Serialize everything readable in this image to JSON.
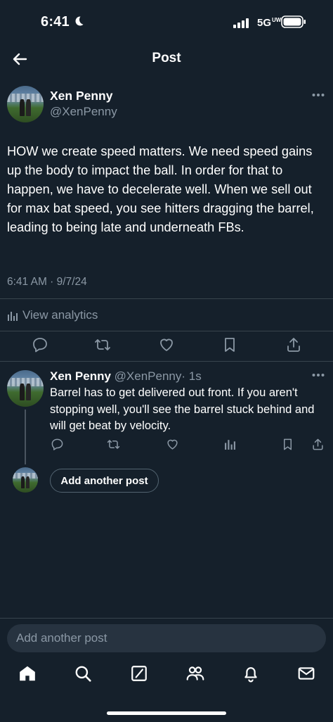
{
  "status_bar": {
    "time": "6:41",
    "network": "5G",
    "network_sub": "UW"
  },
  "header": {
    "title": "Post"
  },
  "main_post": {
    "author_name": "Xen Penny",
    "handle": "@XenPenny",
    "text": "HOW we create speed matters. We need speed gains up the body to impact the ball. In order for that to happen, we have to decelerate well. When we sell out for max bat speed, you see hitters dragging the barrel, leading to being late and underneath FBs.",
    "timestamp": "6:41 AM · 9/7/24",
    "analytics_label": "View analytics"
  },
  "reply": {
    "author_name": "Xen Penny",
    "handle": "@XenPenny",
    "time": "· 1s",
    "text": "Barrel has to get delivered out front. If you aren't stopping well, you'll see the barrel stuck behind and will get beat by velocity."
  },
  "compose": {
    "button_label": "Add another post"
  },
  "bottom_input": {
    "placeholder": "Add another post"
  },
  "icons": [
    "back-arrow-icon",
    "more-icon",
    "reply-icon",
    "repost-icon",
    "like-icon",
    "bookmark-icon",
    "share-icon",
    "analytics-icon",
    "home-icon",
    "search-icon",
    "grok-icon",
    "communities-icon",
    "notifications-icon",
    "messages-icon"
  ],
  "colors": {
    "background": "#15202b",
    "text": "#ffffff",
    "muted": "#8b98a5",
    "divider": "#38444d",
    "input_bg": "#273340"
  }
}
